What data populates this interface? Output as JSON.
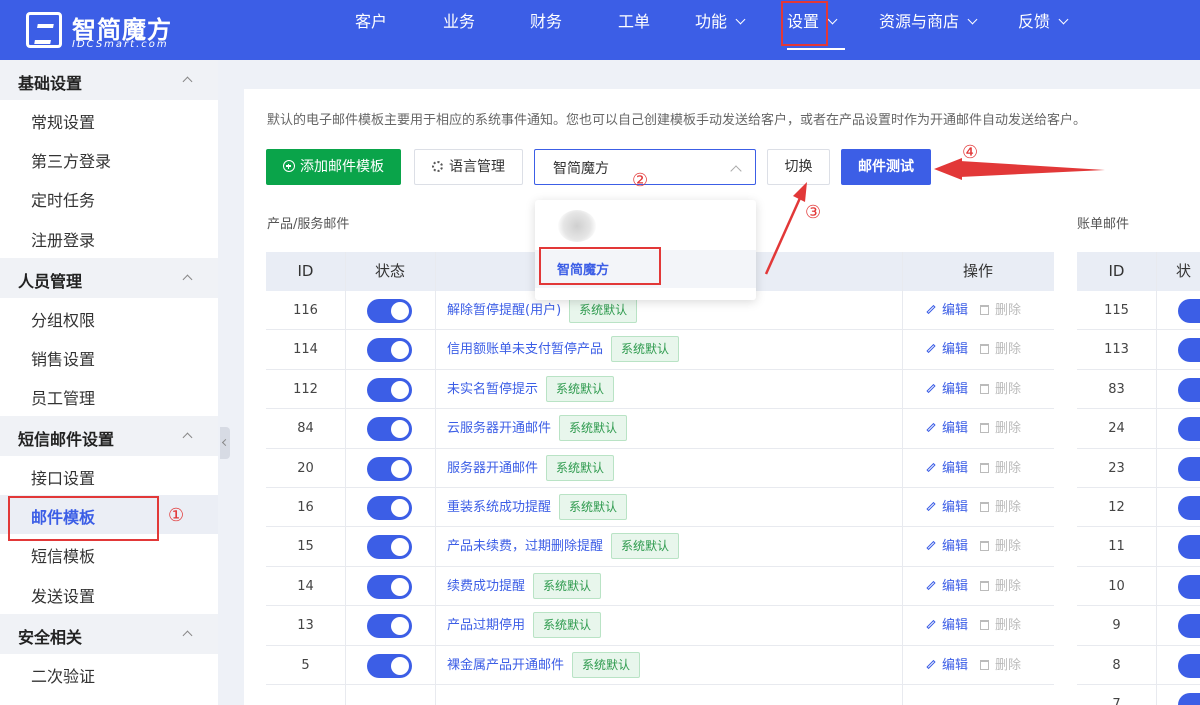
{
  "brand": {
    "name_cn": "智简魔方",
    "name_en": "IDCSmart.com"
  },
  "nav": [
    {
      "label": "客户",
      "has_dropdown": false
    },
    {
      "label": "业务",
      "has_dropdown": false
    },
    {
      "label": "财务",
      "has_dropdown": false
    },
    {
      "label": "工单",
      "has_dropdown": false
    },
    {
      "label": "功能",
      "has_dropdown": true
    },
    {
      "label": "设置",
      "has_dropdown": true,
      "active": true
    },
    {
      "label": "资源与商店",
      "has_dropdown": true
    },
    {
      "label": "反馈",
      "has_dropdown": true
    }
  ],
  "sidebar": {
    "groups": [
      {
        "label": "基础设置",
        "items": [
          "常规设置",
          "第三方登录",
          "定时任务",
          "注册登录"
        ]
      },
      {
        "label": "人员管理",
        "items": [
          "分组权限",
          "销售设置",
          "员工管理"
        ]
      },
      {
        "label": "短信邮件设置",
        "items": [
          "接口设置",
          "邮件模板",
          "短信模板",
          "发送设置"
        ]
      },
      {
        "label": "安全相关",
        "items": [
          "二次验证"
        ]
      }
    ],
    "active_item": "邮件模板"
  },
  "main": {
    "description": "默认的电子邮件模板主要用于相应的系统事件通知。您也可以自己创建模板手动发送给客户，或者在产品设置时作为开通邮件自动发送给客户。",
    "add_button": "添加邮件模板",
    "lang_button": "语言管理",
    "select_value": "智简魔方",
    "switch_button": "切换",
    "test_button": "邮件测试",
    "dropdown_option": "智简魔方",
    "section_product": "产品/服务邮件",
    "section_bill": "账单邮件",
    "columns": {
      "id": "ID",
      "status": "状态",
      "ops": "操作",
      "status_partial": "状"
    },
    "edit_label": "编辑",
    "delete_label": "删除",
    "badge": "系统默认",
    "product_rows": [
      {
        "id": "116",
        "name": "解除暂停提醒(用户)",
        "enabled": true
      },
      {
        "id": "114",
        "name": "信用额账单未支付暂停产品",
        "enabled": true
      },
      {
        "id": "112",
        "name": "未实名暂停提示",
        "enabled": true
      },
      {
        "id": "84",
        "name": "云服务器开通邮件",
        "enabled": true
      },
      {
        "id": "20",
        "name": "服务器开通邮件",
        "enabled": true
      },
      {
        "id": "16",
        "name": "重装系统成功提醒",
        "enabled": true
      },
      {
        "id": "15",
        "name": "产品未续费，过期删除提醒",
        "enabled": true
      },
      {
        "id": "14",
        "name": "续费成功提醒",
        "enabled": true
      },
      {
        "id": "13",
        "name": "产品过期停用",
        "enabled": true
      },
      {
        "id": "5",
        "name": "裸金属产品开通邮件",
        "enabled": true
      }
    ],
    "bill_rows": [
      "115",
      "113",
      "83",
      "24",
      "23",
      "12",
      "11",
      "10",
      "9",
      "8",
      "7"
    ]
  },
  "annotations": [
    "①",
    "②",
    "③",
    "④"
  ],
  "colors": {
    "primary": "#3c5ee6",
    "green": "#0aa44a",
    "annotation_red": "#e23838",
    "badge_green": "#2d9a4d"
  },
  "icons": [
    "logo-icon",
    "chevron-down-icon",
    "plus-circle-icon",
    "gear-icon",
    "edit-icon",
    "trash-icon",
    "toggle-switch"
  ]
}
